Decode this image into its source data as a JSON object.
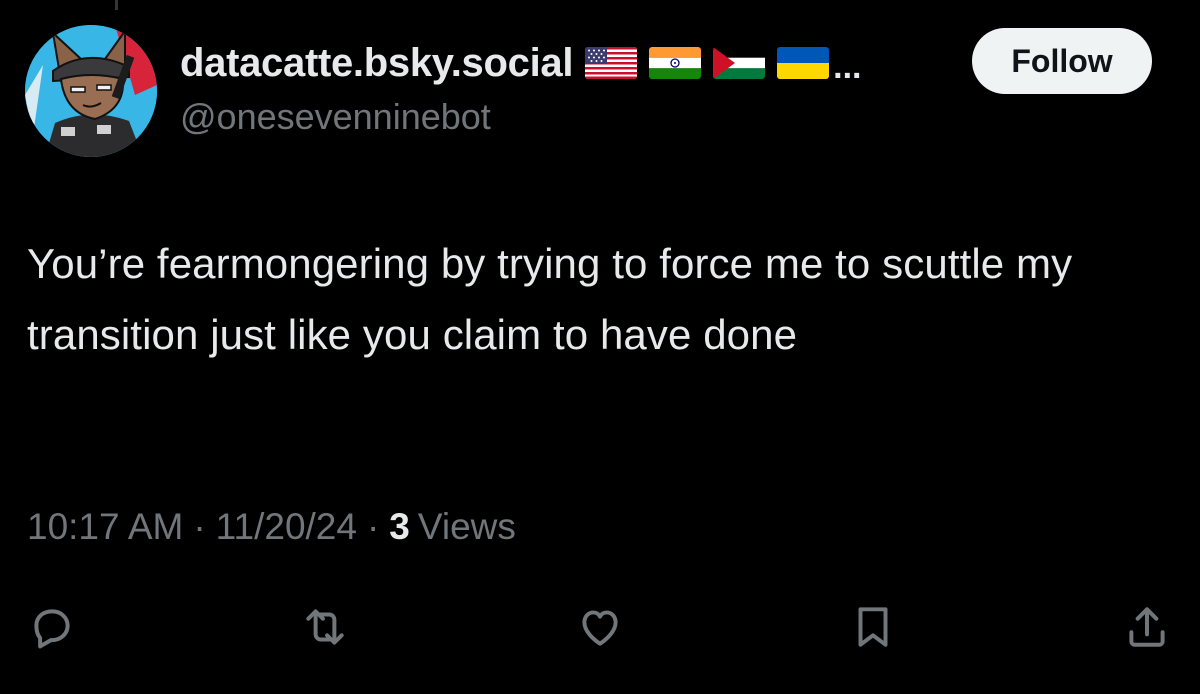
{
  "user": {
    "display_name": "datacatte.bsky.social",
    "flags": [
      "us-flag-icon",
      "india-flag-icon",
      "palestine-flag-icon",
      "ukraine-flag-icon"
    ],
    "overflow": "...",
    "handle": "@onesevenninebot"
  },
  "follow_label": "Follow",
  "tweet": {
    "text": "You’re fearmongering by trying to force me to scuttle my transition just like you claim to have done"
  },
  "meta": {
    "time": "10:17 AM",
    "separator": "·",
    "date": "11/20/24",
    "views_count": "3",
    "views_label": "Views"
  },
  "actions": [
    "reply-icon",
    "repost-icon",
    "like-icon",
    "bookmark-icon",
    "share-icon"
  ],
  "colors": {
    "background": "#000000",
    "primary_text": "#e7e9ea",
    "secondary_text": "#71767b",
    "follow_bg": "#eff3f4",
    "follow_text": "#0f1419"
  }
}
